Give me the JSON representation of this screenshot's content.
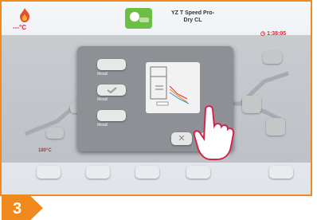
{
  "header": {
    "temperature": "---°C",
    "program_title_line1": "YZ T Speed Pro-",
    "program_title_line2": "Dry CL",
    "timer": "1:38:05"
  },
  "step_number": "3",
  "dialog": {
    "options": [
      "Metall",
      "Metall",
      "Metall"
    ],
    "cancel_symbol": "✕",
    "confirm_symbol": "✓"
  },
  "left_label": "180°C",
  "colors": {
    "accent": "#f08a1e",
    "program_green": "#6cbe45",
    "alert_red": "#dd2233"
  }
}
